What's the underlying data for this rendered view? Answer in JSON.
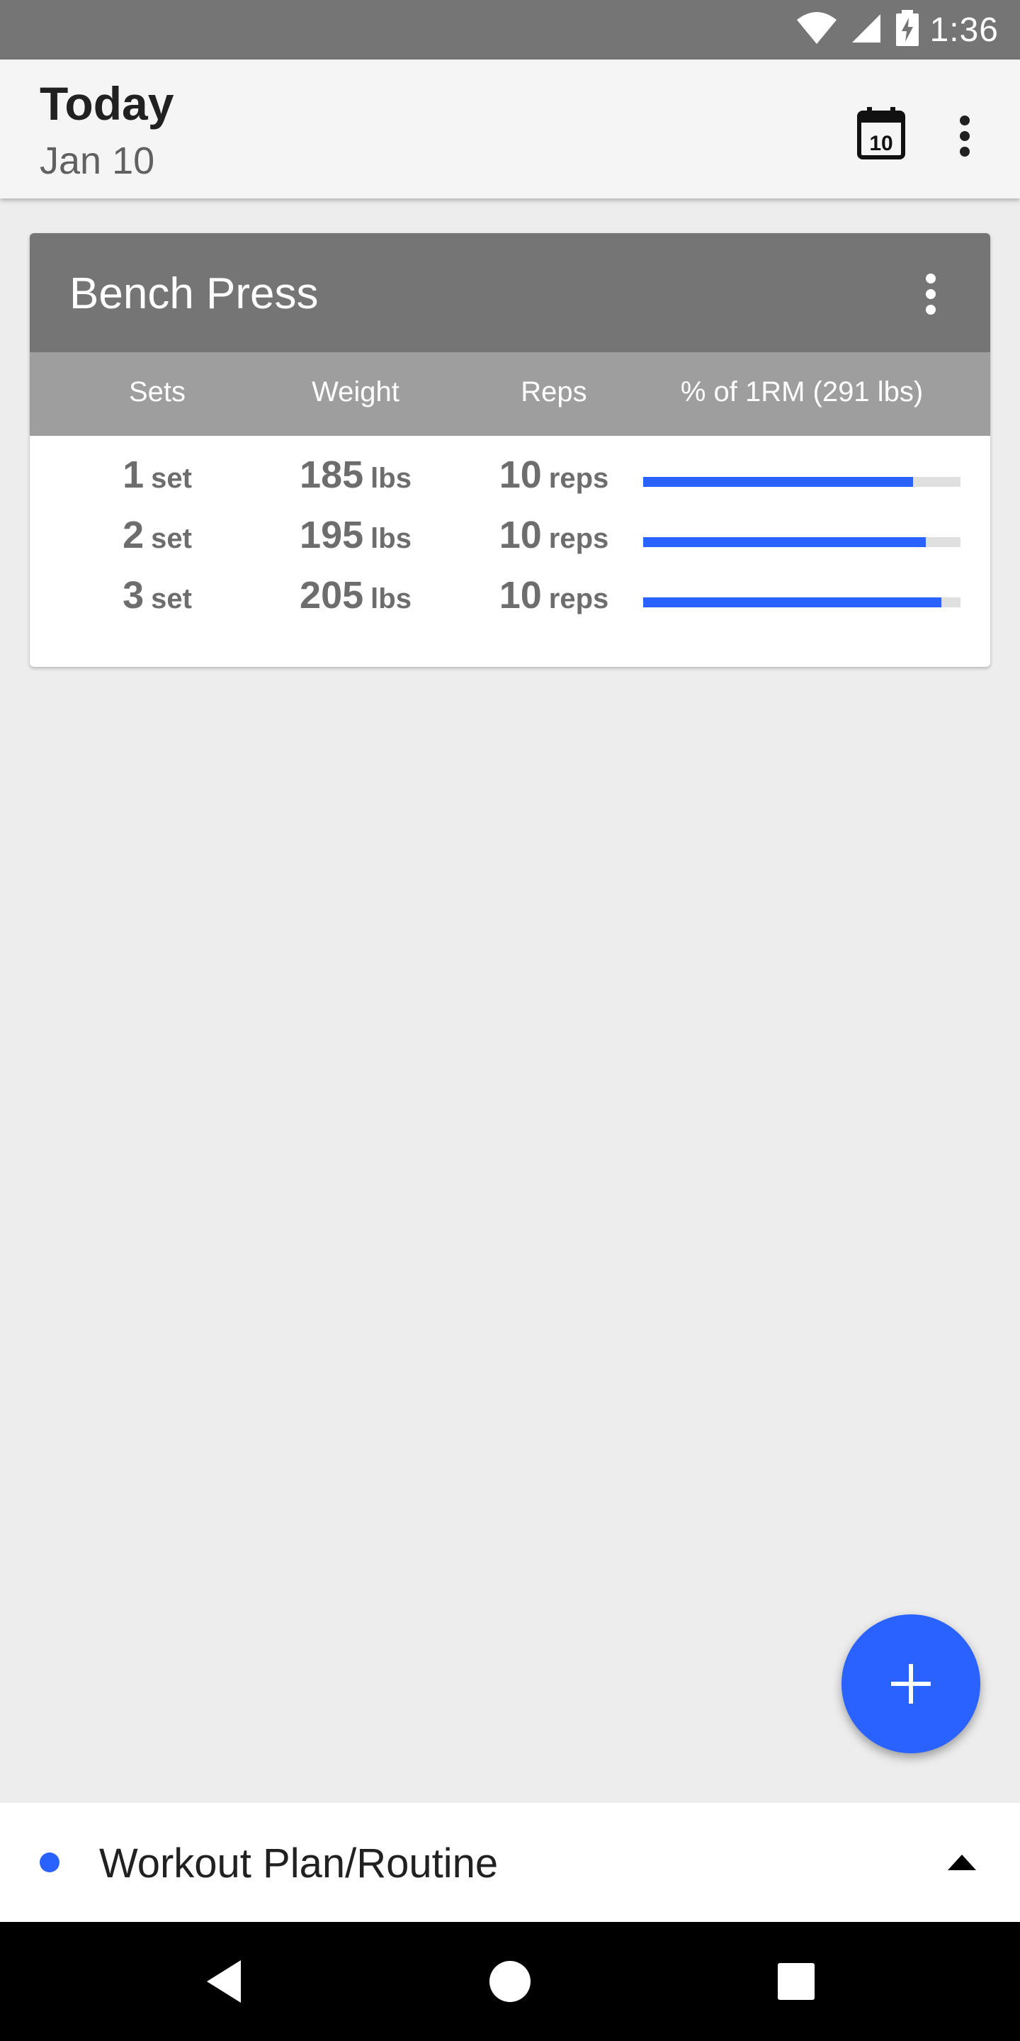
{
  "status_bar": {
    "time": "1:36",
    "icons": [
      "wifi-icon",
      "cell-signal-icon",
      "battery-charging-icon"
    ]
  },
  "app_bar": {
    "title": "Today",
    "subtitle": "Jan 10",
    "calendar_day": "10",
    "icons": [
      "calendar-icon",
      "more-vert-icon"
    ]
  },
  "exercise_card": {
    "title": "Bench Press",
    "columns": {
      "sets": "Sets",
      "weight": "Weight",
      "reps": "Reps",
      "one_rm": "% of 1RM (291 lbs)"
    },
    "rows": [
      {
        "set_num": "1",
        "set_unit": "set",
        "weight": "185",
        "weight_unit": "lbs",
        "reps": "10",
        "reps_unit": "reps",
        "percent_1rm": 0.85
      },
      {
        "set_num": "2",
        "set_unit": "set",
        "weight": "195",
        "weight_unit": "lbs",
        "reps": "10",
        "reps_unit": "reps",
        "percent_1rm": 0.89
      },
      {
        "set_num": "3",
        "set_unit": "set",
        "weight": "205",
        "weight_unit": "lbs",
        "reps": "10",
        "reps_unit": "reps",
        "percent_1rm": 0.94
      }
    ]
  },
  "fab": {
    "icon": "add-icon"
  },
  "bottom_sheet": {
    "label": "Workout Plan/Routine",
    "icon": "expand-up-icon"
  },
  "nav_bar": {
    "icons": [
      "back-icon",
      "home-icon",
      "recents-icon"
    ]
  },
  "colors": {
    "accent": "#2962ff",
    "card_header": "#757575",
    "column_header": "#9e9e9e",
    "status_bar": "#757575",
    "background": "#ededed"
  }
}
